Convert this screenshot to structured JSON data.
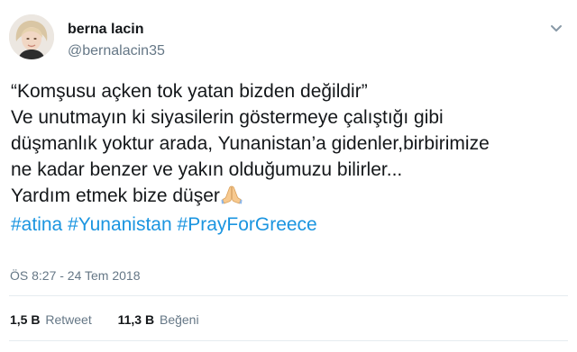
{
  "user": {
    "display_name": "berna lacin",
    "handle": "@bernalacin35"
  },
  "tweet": {
    "lines": [
      "“Komşusu açken tok yatan bizden değildir”",
      "Ve unutmayın ki siyasilerin göstermeye çalıştığı  gibi",
      "düşmanlık yoktur arada, Yunanistan’a gidenler,birbirimize",
      "ne kadar benzer ve yakın olduğumuzu bilirler...",
      "Yardım etmek bize düşer"
    ],
    "emoji": "praying-hands",
    "hashtags": [
      "#atina",
      "#Yunanistan",
      "#PrayForGreece"
    ]
  },
  "meta": {
    "timestamp": "ÖS 8:27 - 24 Tem 2018"
  },
  "stats": {
    "retweets_count": "1,5 B",
    "retweets_label": "Retweet",
    "likes_count": "11,3 B",
    "likes_label": "Beğeni"
  },
  "icons": {
    "menu": "chevron-down-icon"
  },
  "colors": {
    "link": "#1b95e0",
    "secondary_text": "#657786",
    "primary_text": "#14171a",
    "divider": "#e6ecf0"
  }
}
